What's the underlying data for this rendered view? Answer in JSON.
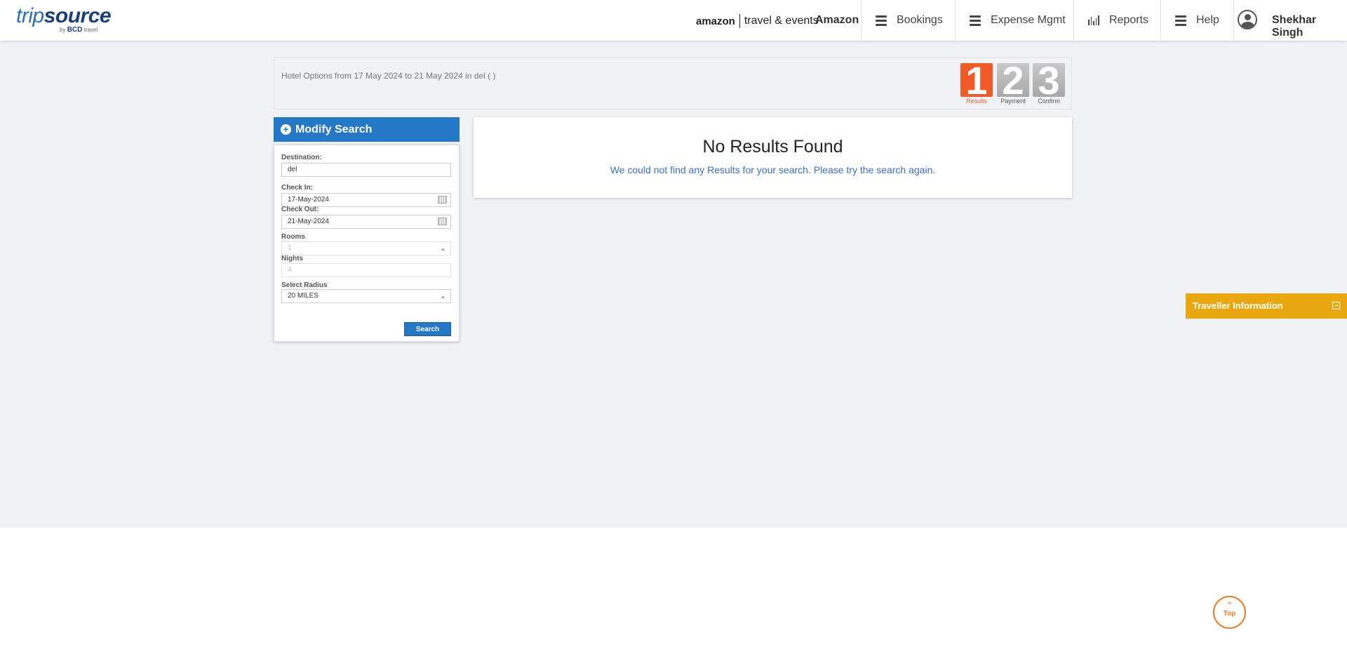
{
  "header": {
    "logo": {
      "trip": "trip",
      "source": "source",
      "by": "by",
      "bcd": "BCD",
      "travel": "travel"
    },
    "brand": {
      "amazon": "amazon",
      "travel_events": "travel & events"
    },
    "company": "Amazon",
    "nav": [
      {
        "label": "Bookings",
        "icon": "menu-icon"
      },
      {
        "label": "Expense Mgmt",
        "icon": "menu-icon"
      },
      {
        "label": "Reports",
        "icon": "bar-chart-icon"
      },
      {
        "label": "Help",
        "icon": "menu-icon"
      }
    ],
    "user_name": "Shekhar Singh"
  },
  "infobar": {
    "text": "Hotel Options from  17 May 2024 to 21 May 2024 in del ( )",
    "steps": [
      {
        "number": "1",
        "label": "Results",
        "active": true
      },
      {
        "number": "2",
        "label": "Payment",
        "active": false
      },
      {
        "number": "3",
        "label": "Confirm",
        "active": false
      }
    ]
  },
  "modify_search": {
    "title": "Modify Search",
    "destination_label": "Destination:",
    "destination_value": "del",
    "checkin_label": "Check In:",
    "checkin_value": "17-May-2024",
    "checkout_label": "Check Out:",
    "checkout_value": "21-May-2024",
    "rooms_label": "Rooms",
    "rooms_value": "1",
    "nights_label": "Nights",
    "nights_value": "4",
    "radius_label": "Select Radius",
    "radius_value": "20 MILES",
    "search_button": "Search"
  },
  "results": {
    "title": "No Results Found",
    "message": "We could not find any Results for your search. Please try the search again."
  },
  "traveller": {
    "label": "Traveller Information"
  },
  "top_button": {
    "label": "Top"
  },
  "colors": {
    "accent_blue": "#2578c5",
    "step_active": "#f05a28",
    "traveller_bar": "#e9a80f",
    "top_button": "#f07a20"
  }
}
